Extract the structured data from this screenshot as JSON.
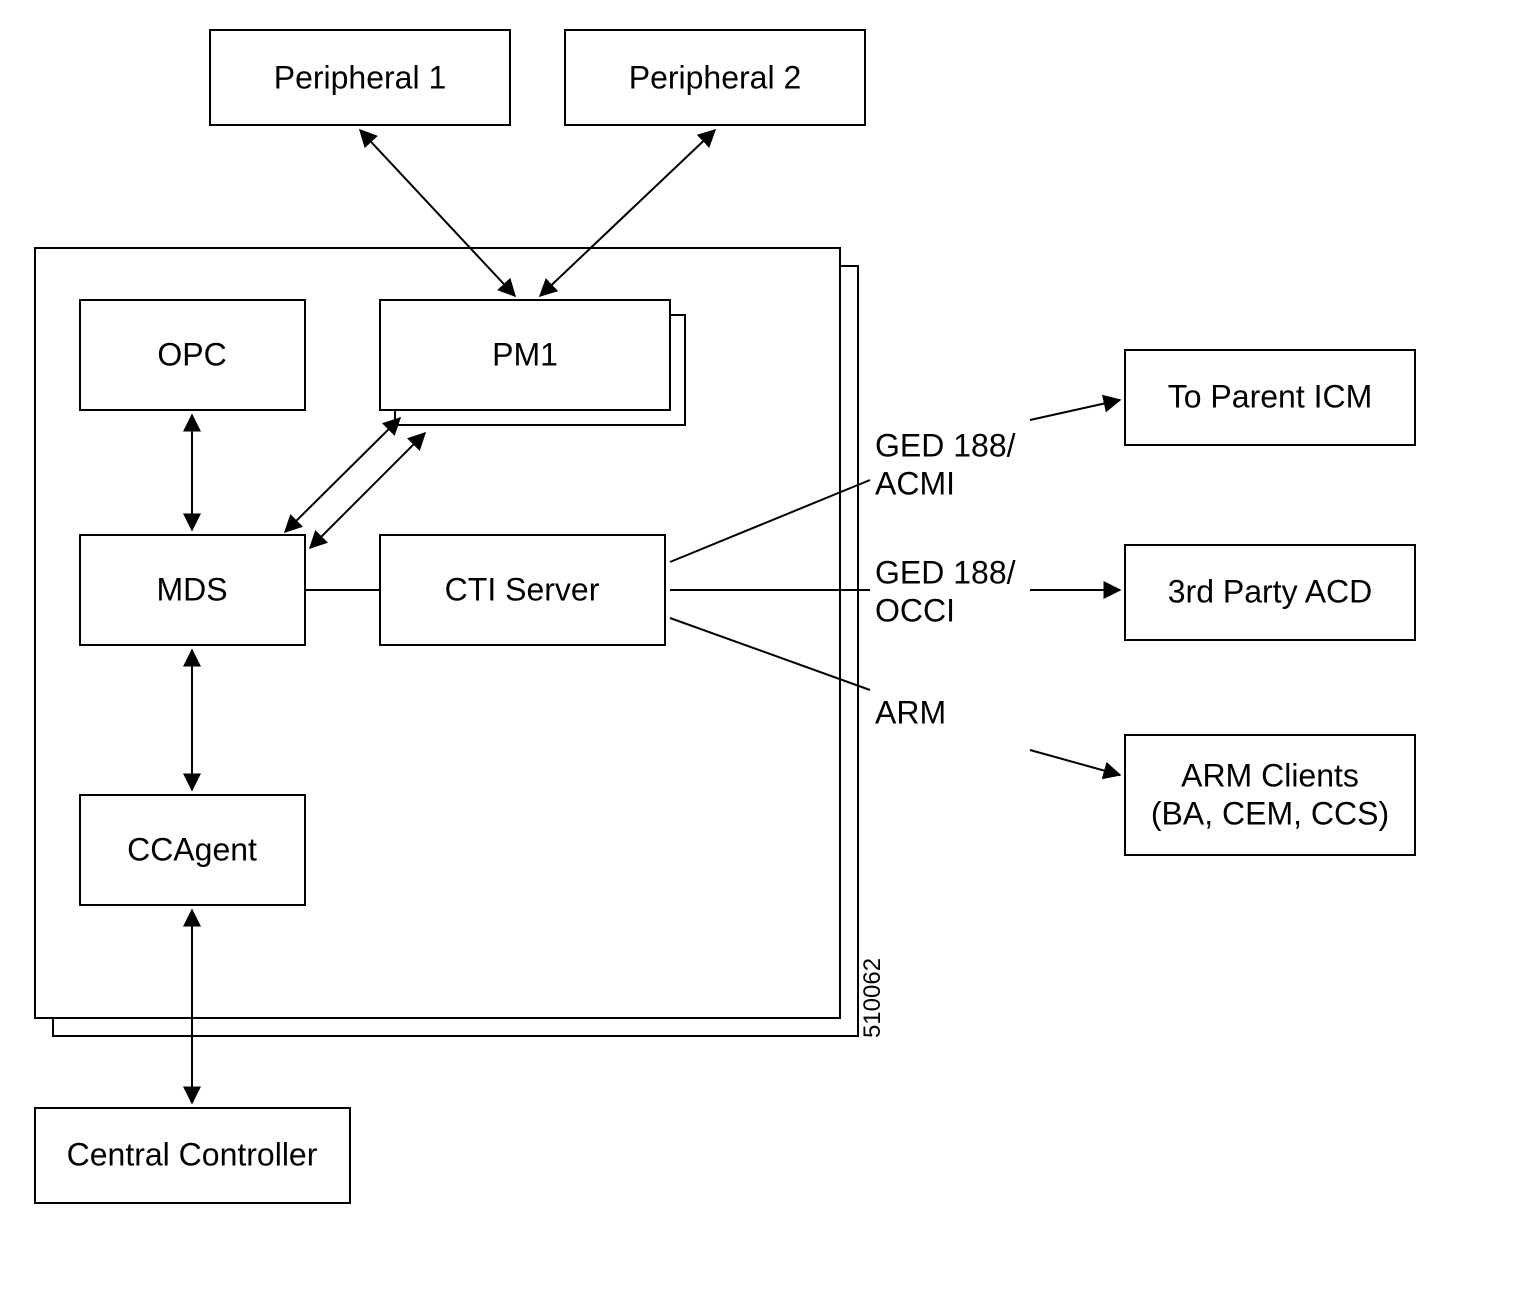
{
  "nodes": {
    "peripheral1": "Peripheral 1",
    "peripheral2": "Peripheral 2",
    "opc": "OPC",
    "pm1": "PM1",
    "mds": "MDS",
    "cti": "CTI Server",
    "ccagent": "CCAgent",
    "central": "Central Controller",
    "parent_icm": "To Parent ICM",
    "third_party": "3rd Party ACD",
    "arm_clients_l1": "ARM Clients",
    "arm_clients_l2": "(BA, CEM, CCS)"
  },
  "edges": {
    "ged_acmi_l1": "GED 188/",
    "ged_acmi_l2": "ACMI",
    "ged_occi_l1": "GED 188/",
    "ged_occi_l2": "OCCI",
    "arm": "ARM"
  },
  "figure_id": "510062"
}
